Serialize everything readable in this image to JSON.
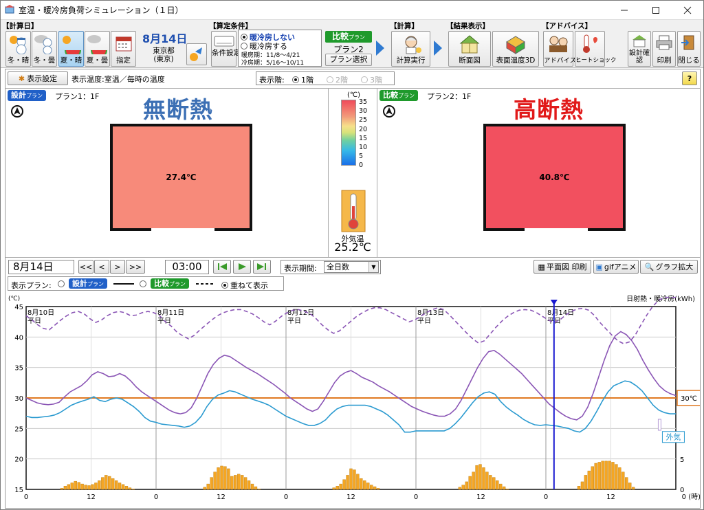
{
  "window": {
    "title": "室温・暖冷房負荷シミュレーション（１日）"
  },
  "toolbar": {
    "group_calc_day": "【計算日】",
    "day_buttons": [
      {
        "label": "冬・晴",
        "icon": "snowman-sun-icon"
      },
      {
        "label": "冬・曇",
        "icon": "snowman-cloud-icon"
      },
      {
        "label": "夏・晴",
        "icon": "watermelon-sun-icon",
        "active": true
      },
      {
        "label": "夏・曇",
        "icon": "watermelon-cloud-icon"
      },
      {
        "label": "指定",
        "icon": "calendar-icon"
      }
    ],
    "date": "8月14日",
    "location": "東京都",
    "location_sub": "(東京)",
    "group_conditions": "【算定条件】",
    "condition_button": "条件設定",
    "heating_options": [
      "暖冷房しない",
      "暖冷房する"
    ],
    "heating_selected": 0,
    "heating_period": "暖房期：11/8～4/21",
    "cooling_period": "冷房期：5/16～10/11",
    "compare_label": "比較",
    "compare_small": "プラン",
    "compare_plan": "プラン2",
    "plan_select": "プラン選択",
    "group_calc": "【計算】",
    "calc_button": "計算実行",
    "group_results": "【結果表示】",
    "section_button": "断面図",
    "surface_button": "表面温度3D",
    "group_advice": "【アドバイス】",
    "advice_button": "アドバイス",
    "heatshock_button": "ヒートショック",
    "design_check": "設計確認",
    "print": "印刷",
    "close": "閉じる"
  },
  "display_bar": {
    "settings_button": "表示設定",
    "temp_label": "表示温度:室温／毎時の温度",
    "floor_label": "表示階:",
    "floors": [
      "1階",
      "2階",
      "3階"
    ],
    "floor_selected": 0,
    "help": "?"
  },
  "plans": {
    "left": {
      "badge": "設計",
      "badge_small": "プラン",
      "name": "プラン1：1F",
      "title": "無断熱",
      "title_color": "#3c6fb4",
      "temp": "27.4℃",
      "fill": "#f78a7a"
    },
    "right": {
      "badge": "比較",
      "badge_small": "プラン",
      "name": "プラン2：1F",
      "title": "高断熱",
      "title_color": "#e11919",
      "temp": "40.8℃",
      "fill": "#f2505f"
    }
  },
  "legend": {
    "unit": "(℃)",
    "ticks": [
      "35",
      "30",
      "25",
      "20",
      "15",
      "10",
      "5",
      "0"
    ],
    "outside_label": "外気温",
    "outside_value": "25.2℃"
  },
  "controls": {
    "date": "8月14日",
    "nav": [
      "<<",
      "<",
      ">",
      ">>"
    ],
    "time": "03:00",
    "period_label": "表示期間:",
    "period_value": "全日数",
    "plan_print": "平面図 印刷",
    "gif": "gifアニメ",
    "graph_zoom": "グラフ拡大",
    "display_plan_label": "表示プラン:",
    "design_badge": "設計",
    "compare_badge": "比較",
    "overlay_label": "重ねて表示"
  },
  "chart_data": {
    "type": "line",
    "ylabel": "(℃)",
    "y2label": "日射熱・暖冷房(kWh)",
    "ylim": [
      15,
      45
    ],
    "yticks": [
      "45",
      "40",
      "35",
      "30",
      "25",
      "20",
      "15"
    ],
    "y2ticks": [
      "5",
      "0"
    ],
    "xticks": [
      "0",
      "12",
      "0",
      "12",
      "0",
      "12",
      "0",
      "12",
      "0",
      "12",
      "0 (時)"
    ],
    "days": [
      {
        "date": "8月10日",
        "type": "平日"
      },
      {
        "date": "8月11日",
        "type": "平日"
      },
      {
        "date": "8月12日",
        "type": "平日"
      },
      {
        "date": "8月13日",
        "type": "平日"
      },
      {
        "date": "8月14日",
        "type": "平日"
      }
    ],
    "reference_line": {
      "value": 30,
      "label": "30℃",
      "color": "#e07820"
    },
    "current_time_marker": "8月14日 03:00",
    "outside_label": "外気",
    "series": [
      {
        "name": "比較プラン (高断熱)",
        "style": "dashed",
        "color": "#8a55b5",
        "values": [
          43.5,
          42.8,
          42.0,
          41.4,
          41.2,
          42.0,
          42.8,
          43.5,
          44.0,
          44.2,
          43.8,
          43.0,
          42.4,
          42.8,
          43.5,
          44.0,
          44.2,
          44.0,
          43.5,
          43.6,
          44.0,
          44.2,
          44.0,
          43.5,
          42.5,
          41.8,
          40.8,
          40.2,
          39.7,
          40.3,
          41.2,
          42.0,
          42.8,
          43.5,
          44.0,
          44.3,
          44.5,
          44.5,
          44.2,
          43.8,
          43.2,
          42.5,
          42.0,
          42.6,
          43.4,
          44.0,
          44.4,
          44.5,
          44.2,
          43.8,
          43.0,
          42.0,
          41.2,
          40.6,
          41.0,
          41.8,
          42.6,
          43.4,
          44.0,
          44.5,
          44.8,
          44.8,
          44.5,
          44.0,
          43.5,
          43.0,
          42.5,
          42.8,
          43.4,
          44.0,
          44.5,
          44.8,
          44.5,
          43.6,
          42.6,
          41.6,
          40.6,
          39.7,
          39.0,
          39.4,
          40.5,
          41.6,
          42.6,
          43.4,
          44.0,
          44.4,
          44.5,
          44.4,
          44.0,
          43.4,
          42.8,
          42.4,
          42.8,
          43.6,
          44.2,
          44.6,
          44.7,
          44.4,
          43.5,
          42.3,
          41.3,
          40.3,
          39.4,
          38.9,
          39.2,
          40.3,
          42.0,
          43.6,
          45.0,
          46.0,
          46.5,
          46.5,
          46.5
        ]
      },
      {
        "name": "設計プラン (無断熱)",
        "style": "solid",
        "color": "#8a55b5",
        "values": [
          30.0,
          29.6,
          29.2,
          29.0,
          28.9,
          29.0,
          29.3,
          30.2,
          31.0,
          31.5,
          32.0,
          32.8,
          33.8,
          34.3,
          34.0,
          33.5,
          33.6,
          34.0,
          33.6,
          32.8,
          31.8,
          31.0,
          30.4,
          29.8,
          29.2,
          28.6,
          28.0,
          27.6,
          27.4,
          27.6,
          28.4,
          30.0,
          32.0,
          34.0,
          35.5,
          36.5,
          37.0,
          36.8,
          36.2,
          35.6,
          35.0,
          34.5,
          34.0,
          33.4,
          32.8,
          32.2,
          31.5,
          30.8,
          30.0,
          29.4,
          28.8,
          28.2,
          27.8,
          28.2,
          29.5,
          31.0,
          32.5,
          33.6,
          34.2,
          34.5,
          34.0,
          33.4,
          33.0,
          32.6,
          32.0,
          31.5,
          31.0,
          30.4,
          29.8,
          29.2,
          28.6,
          28.2,
          27.8,
          27.5,
          27.2,
          27.0,
          27.0,
          27.4,
          28.2,
          29.6,
          31.4,
          33.2,
          35.0,
          36.5,
          37.6,
          37.8,
          37.2,
          36.4,
          35.6,
          34.8,
          34.0,
          33.0,
          32.0,
          31.0,
          30.0,
          29.0,
          28.3,
          27.6,
          27.0,
          26.6,
          26.4,
          27.0,
          28.5,
          30.8,
          33.5,
          36.2,
          38.6,
          40.2,
          40.9,
          40.4,
          39.4,
          38.0,
          36.2,
          34.6,
          33.2,
          32.0,
          31.2,
          30.7,
          30.4
        ]
      },
      {
        "name": "比較プラン 室温",
        "style": "solid",
        "color": "#2a9ad0",
        "values": [
          27.0,
          26.8,
          26.8,
          26.9,
          27.0,
          27.2,
          27.6,
          28.2,
          28.8,
          29.2,
          29.5,
          29.8,
          30.2,
          29.6,
          29.4,
          29.8,
          30.0,
          29.8,
          29.2,
          28.6,
          27.8,
          26.8,
          26.2,
          26.0,
          25.7,
          25.6,
          25.5,
          25.4,
          25.2,
          25.4,
          26.0,
          27.0,
          28.6,
          29.8,
          30.5,
          30.8,
          31.2,
          31.0,
          30.6,
          30.2,
          29.8,
          29.5,
          29.2,
          28.8,
          28.2,
          27.6,
          27.0,
          26.6,
          26.2,
          25.8,
          25.5,
          25.5,
          25.8,
          26.4,
          27.4,
          28.2,
          28.6,
          28.8,
          28.8,
          28.8,
          28.8,
          28.6,
          28.2,
          27.8,
          27.2,
          26.4,
          25.6,
          24.4,
          24.4,
          24.6,
          24.6,
          24.6,
          24.6,
          24.6,
          24.6,
          25.0,
          25.8,
          26.8,
          28.0,
          29.2,
          30.2,
          30.8,
          31.0,
          30.6,
          29.4,
          28.5,
          27.8,
          27.2,
          26.5,
          26.0,
          25.6,
          25.5,
          25.6,
          25.5,
          25.4,
          25.2,
          25.0,
          24.6,
          24.4,
          25.0,
          26.2,
          27.8,
          29.5,
          31.0,
          32.0,
          32.4,
          32.8,
          32.6,
          32.0,
          31.2,
          30.0,
          28.8,
          28.0,
          27.6,
          27.4,
          27.4
        ]
      }
    ],
    "bars": {
      "color": "#f5a623",
      "values": [
        0,
        0,
        0,
        0,
        0,
        0,
        0,
        0,
        0,
        0,
        0.2,
        0.6,
        0.9,
        1.2,
        1.5,
        1.3,
        1.0,
        0.8,
        0.7,
        0.9,
        1.2,
        1.6,
        2.2,
        2.6,
        2.4,
        2.0,
        1.6,
        1.2,
        0.9,
        0.6,
        0.3,
        0.1,
        0,
        0,
        0,
        0,
        0,
        0,
        0,
        0,
        0,
        0,
        0,
        0,
        0,
        0,
        0,
        0,
        0,
        0,
        0,
        0,
        0.4,
        1.0,
        2.2,
        3.2,
        4.0,
        4.3,
        4.2,
        3.8,
        2.4,
        2.6,
        2.8,
        2.6,
        2.2,
        1.6,
        1.0,
        0.5,
        0.1,
        0,
        0,
        0,
        0,
        0,
        0,
        0,
        0,
        0,
        0,
        0,
        0,
        0,
        0,
        0,
        0,
        0,
        0,
        0,
        0,
        0,
        0.3,
        0.6,
        1.0,
        1.8,
        2.6,
        3.8,
        3.6,
        2.8,
        2.0,
        1.6,
        1.2,
        0.8,
        0.5,
        0.2,
        0,
        0,
        0,
        0,
        0,
        0,
        0,
        0,
        0,
        0,
        0,
        0,
        0,
        0,
        0,
        0,
        0,
        0,
        0,
        0,
        0,
        0,
        0,
        0.4,
        0.8,
        1.4,
        2.4,
        3.2,
        4.4,
        4.6,
        4.0,
        3.2,
        2.6,
        2.2,
        1.6,
        1.0,
        0.5,
        0.1,
        0,
        0,
        0,
        0,
        0,
        0,
        0,
        0,
        0,
        0,
        0,
        0,
        0,
        0,
        0,
        0,
        0,
        0,
        0,
        0,
        0.6,
        1.4,
        2.6,
        3.4,
        4.2,
        4.8,
        5.0,
        5.2,
        5.2,
        5.2,
        5.0,
        4.6,
        4.0,
        3.2,
        2.2,
        1.2,
        0.4,
        0,
        0,
        0,
        0,
        0,
        0,
        0,
        0,
        0,
        0,
        0,
        0
      ]
    }
  }
}
